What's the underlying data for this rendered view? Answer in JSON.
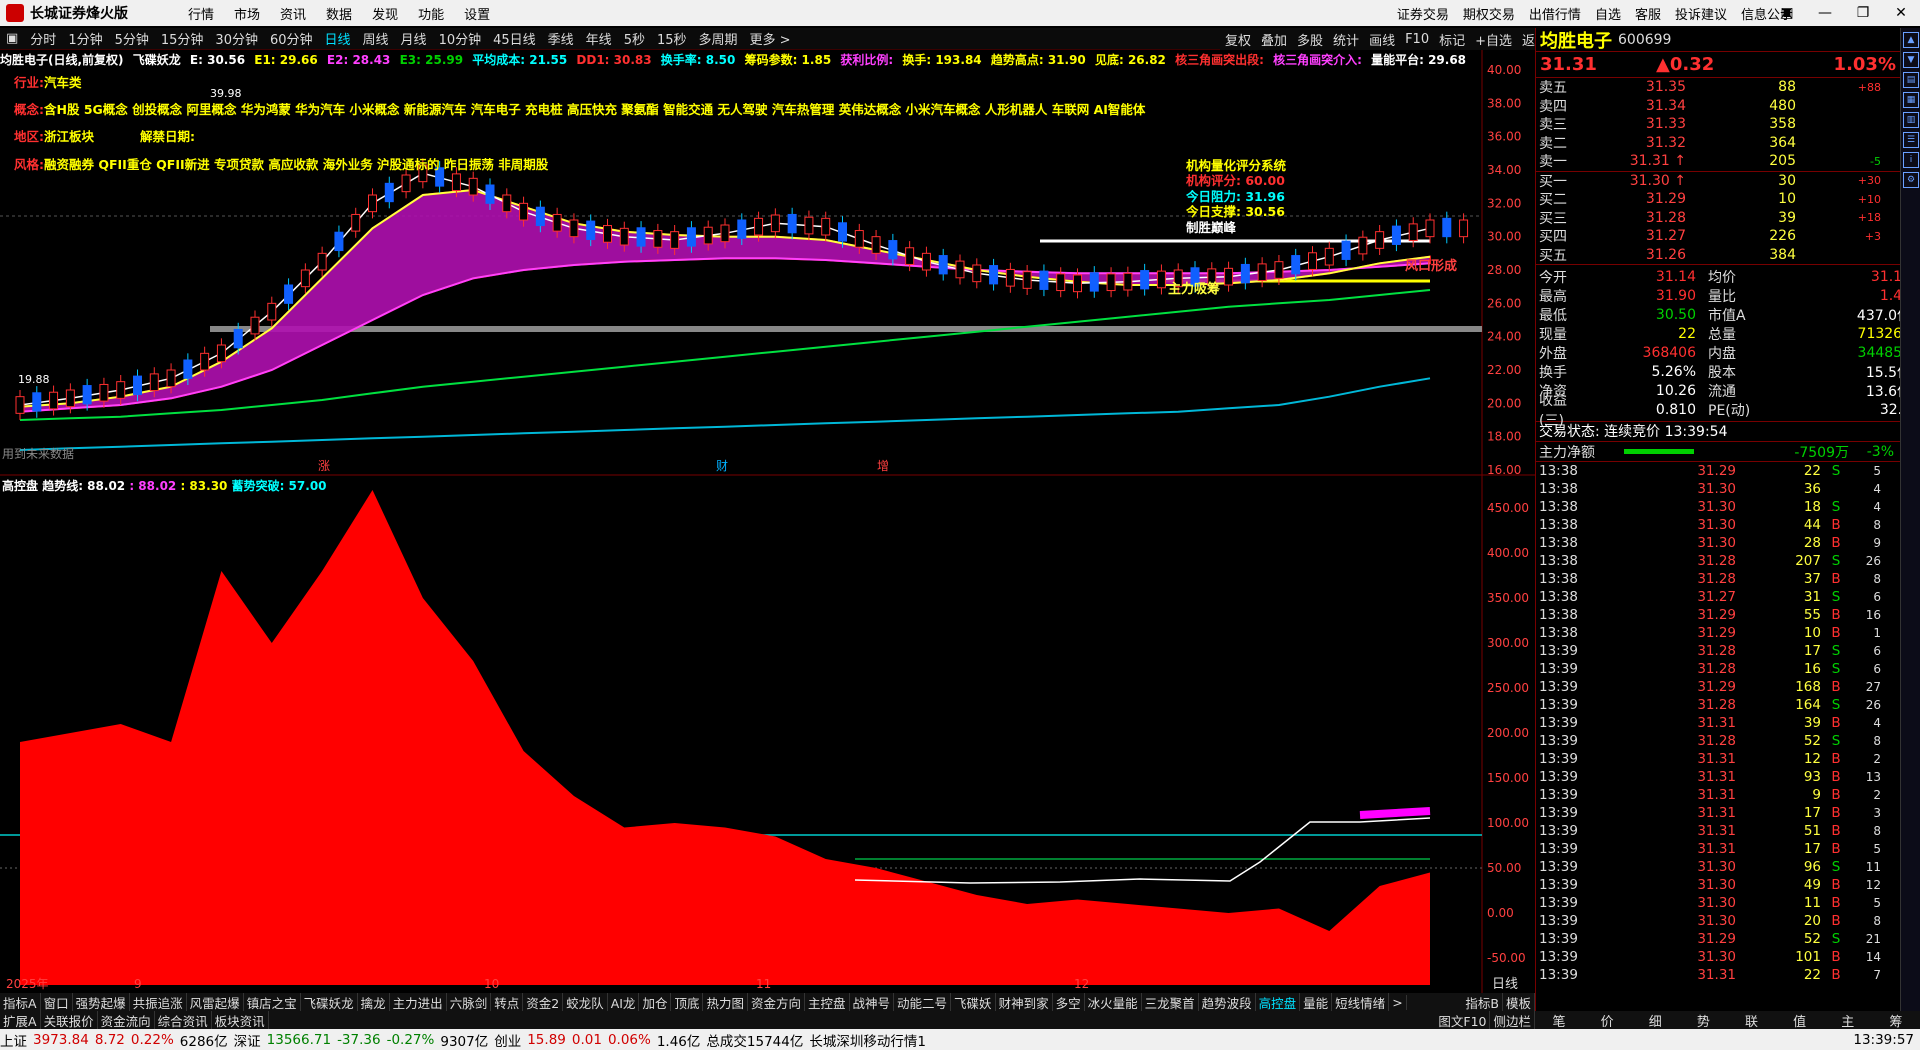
{
  "window": {
    "app_title": "长城证券烽火版",
    "menus": [
      "行情",
      "市场",
      "资讯",
      "数据",
      "发现",
      "功能",
      "设置"
    ],
    "right_menus": [
      "证券交易",
      "期权交易",
      "出借行情",
      "自选",
      "客服",
      "投诉建议",
      "信息公示"
    ],
    "controls": [
      "▣",
      "—",
      "❐",
      "✕"
    ]
  },
  "periods": [
    "分时",
    "1分钟",
    "5分钟",
    "15分钟",
    "30分钟",
    "60分钟",
    "日线",
    "周线",
    "月线",
    "10分钟",
    "45日线",
    "季线",
    "年线",
    "5秒",
    "15秒",
    "多周期",
    "更多 >"
  ],
  "active_period": "日线",
  "chart_tools": [
    "复权",
    "叠加",
    "多股",
    "统计",
    "画线",
    "F10",
    "标记",
    "+自选",
    "返回"
  ],
  "info_bar": {
    "stock": "均胜电子(日线,前复权)",
    "indicator": "飞碟妖龙",
    "e1": "E: 30.56",
    "e1b": "E1: 29.66",
    "e2": "E2: 28.43",
    "e3": "E3: 25.99",
    "avg_cost": "平均成本: 21.55",
    "dd1": "DD1: 30.83",
    "turnover_rate": "换手率: 8.50",
    "chip_param": "筹码参数: 1.85",
    "profit_ratio": "获利比例:",
    "turnover": "换手: 193.84",
    "trend_high": "趋势高点: 31.90",
    "top_hint": "见底: 26.82",
    "triangle_break": "核三角画突出段:",
    "triangle_intervene": "核三角画突介入:",
    "volume_platform": "量能平台: 29.68"
  },
  "stock_info": {
    "industry_label": "行业:",
    "industry": "汽车类",
    "concept_label": "概念:",
    "concept": "含H股 5G概念 创投概念 阿里概念 华为鸿蒙 华为汽车 小米概念 新能源汽车 汽车电子 充电桩 高压快充 聚氨酯 智能交通 无人驾驶 汽车热管理 英伟达概念 小米汽车概念 人形机器人 车联网 AI智能体",
    "region_label": "地区:",
    "region": "浙江板块",
    "unlock_label": "解禁日期:",
    "style_label": "风格:",
    "style": "融资融券 QFII重仓 QFII新进 专项贷款 高应收款 海外业务 沪股通标的 昨日振荡 非周期股"
  },
  "quant_box": {
    "title": "机构量化评分系统",
    "score": "机构评分: 60.00",
    "resistance": "今日阻力: 31.96",
    "support": "今日支撑: 30.56",
    "note": "制胜巅峰"
  },
  "chart_annotations": {
    "peak_price": "39.98",
    "low_price": "19.88",
    "main_label": "主力吸筹",
    "breakout_label": "风口形成",
    "no_future": "用到未来数据",
    "markers": [
      "涨",
      "财",
      "增"
    ],
    "month_labels": [
      "2025年",
      "9",
      "10",
      "11",
      "12",
      "日线"
    ]
  },
  "price_axis": [
    "40.00",
    "38.00",
    "36.00",
    "34.00",
    "32.00",
    "30.00",
    "28.00",
    "26.00",
    "24.00",
    "22.00",
    "20.00",
    "18.00",
    "16.00"
  ],
  "sub_axis": [
    "450.00",
    "400.00",
    "350.00",
    "300.00",
    "250.00",
    "200.00",
    "150.00",
    "100.00",
    "50.00",
    "0.00",
    "-50.00"
  ],
  "sub_indicator": {
    "name": "高控盘",
    "trend": "趋势线: 88.02",
    "v2": ": 88.02",
    "v3": ": 83.30",
    "breakout": "蓄势突破: 57.00"
  },
  "chart_data": [
    {
      "type": "line",
      "ylim": [
        16,
        40
      ],
      "series": [
        {
          "name": "E1",
          "values": [
            19.9,
            20.3,
            20.8,
            21.5,
            23.0,
            25.5,
            28.5,
            32.0,
            33.8,
            33.0,
            31.5,
            30.5,
            30.0,
            29.8,
            30.2,
            30.8,
            30.6,
            29.5,
            28.5,
            27.8,
            27.4,
            27.2,
            27.3,
            27.5,
            27.6,
            28.0,
            28.8,
            29.8,
            30.5
          ]
        },
        {
          "name": "E2",
          "values": [
            19.8,
            20.0,
            20.4,
            21.0,
            22.5,
            24.5,
            27.5,
            30.5,
            32.5,
            32.8,
            31.8,
            30.8,
            30.3,
            30.1,
            30.0,
            30.0,
            29.8,
            29.2,
            28.6,
            28.0,
            27.6,
            27.3,
            27.1,
            27.1,
            27.2,
            27.4,
            27.8,
            28.4,
            28.8
          ]
        },
        {
          "name": "E3",
          "values": [
            19.5,
            19.7,
            19.9,
            20.3,
            21.0,
            22.0,
            23.5,
            25.0,
            26.5,
            27.5,
            28.0,
            28.3,
            28.5,
            28.6,
            28.7,
            28.7,
            28.6,
            28.4,
            28.2,
            28.0,
            27.9,
            27.8,
            27.8,
            27.8,
            27.8,
            27.9,
            28.0,
            28.2,
            28.4
          ]
        },
        {
          "name": "平均成本",
          "values": [
            19.0,
            19.1,
            19.2,
            19.4,
            19.6,
            19.9,
            20.2,
            20.6,
            21.0,
            21.3,
            21.6,
            21.9,
            22.2,
            22.5,
            22.8,
            23.1,
            23.4,
            23.7,
            24.0,
            24.3,
            24.6,
            24.9,
            25.2,
            25.5,
            25.8,
            26.0,
            26.2,
            26.5,
            26.8
          ]
        },
        {
          "name": "DD1",
          "values": [
            17.2,
            17.3,
            17.4,
            17.5,
            17.6,
            17.7,
            17.8,
            17.9,
            18.0,
            18.1,
            18.2,
            18.3,
            18.4,
            18.5,
            18.6,
            18.7,
            18.8,
            18.9,
            19.0,
            19.1,
            19.2,
            19.3,
            19.4,
            19.5,
            19.7,
            19.9,
            20.4,
            21.0,
            21.5
          ]
        }
      ]
    },
    {
      "type": "area",
      "ylim": [
        -80,
        470
      ],
      "series": [
        {
          "name": "高控盘",
          "values": [
            190,
            200,
            210,
            190,
            380,
            300,
            380,
            470,
            350,
            280,
            180,
            130,
            95,
            100,
            95,
            85,
            60,
            50,
            35,
            20,
            10,
            15,
            10,
            5,
            0,
            5,
            -20,
            30,
            45
          ]
        }
      ]
    }
  ],
  "quote_panel": {
    "name": "均胜电子",
    "code": "600699",
    "price": "31.31",
    "change": "▲0.32",
    "pct": "1.03%",
    "asks": [
      {
        "label": "卖五",
        "price": "31.35",
        "vol": "88",
        "chg": "+88"
      },
      {
        "label": "卖四",
        "price": "31.34",
        "vol": "480",
        "chg": ""
      },
      {
        "label": "卖三",
        "price": "31.33",
        "vol": "358",
        "chg": ""
      },
      {
        "label": "卖二",
        "price": "31.32",
        "vol": "364",
        "chg": ""
      },
      {
        "label": "卖一",
        "price": "31.31 ↑",
        "vol": "205",
        "chg": "-5"
      }
    ],
    "bids": [
      {
        "label": "买一",
        "price": "31.30 ↑",
        "vol": "30",
        "chg": "+30"
      },
      {
        "label": "买二",
        "price": "31.29",
        "vol": "10",
        "chg": "+10"
      },
      {
        "label": "买三",
        "price": "31.28",
        "vol": "39",
        "chg": "+18"
      },
      {
        "label": "买四",
        "price": "31.27",
        "vol": "226",
        "chg": "+3"
      },
      {
        "label": "买五",
        "price": "31.26",
        "vol": "384",
        "chg": ""
      }
    ],
    "stats": [
      {
        "k": "今开",
        "v": "31.14",
        "k2": "均价",
        "v2": "31.19"
      },
      {
        "k": "最高",
        "v": "31.90",
        "k2": "量比",
        "v2": "1.42"
      },
      {
        "k": "最低",
        "v": "30.50",
        "k2": "市值A",
        "v2": "437.0亿"
      },
      {
        "k": "现量",
        "v": "22",
        "k2": "总量",
        "v2": "713262"
      },
      {
        "k": "外盘",
        "v": "368406",
        "k2": "内盘",
        "v2": "344856"
      },
      {
        "k": "换手",
        "v": "5.26%",
        "k2": "股本",
        "v2": "15.5亿"
      },
      {
        "k": "净资",
        "v": "10.26",
        "k2": "流通",
        "v2": "13.6亿"
      },
      {
        "k": "收益(三)",
        "v": "0.810",
        "k2": "PE(动)",
        "v2": "32.5"
      }
    ],
    "trade_status": "交易状态: 连续竞价 13:39:54",
    "main_flow_label": "主力净额",
    "main_flow_value": "-7509万",
    "main_flow_pct": "-3%",
    "ticks": [
      {
        "t": "13:38",
        "p": "31.29",
        "v": "22",
        "bs": "S",
        "n": "5"
      },
      {
        "t": "13:38",
        "p": "31.30",
        "v": "36",
        "bs": "",
        "n": "4"
      },
      {
        "t": "13:38",
        "p": "31.30",
        "v": "18",
        "bs": "S",
        "n": "4"
      },
      {
        "t": "13:38",
        "p": "31.30",
        "v": "44",
        "bs": "B",
        "n": "8"
      },
      {
        "t": "13:38",
        "p": "31.30",
        "v": "28",
        "bs": "B",
        "n": "9"
      },
      {
        "t": "13:38",
        "p": "31.28",
        "v": "207",
        "bs": "S",
        "n": "26"
      },
      {
        "t": "13:38",
        "p": "31.28",
        "v": "37",
        "bs": "B",
        "n": "8"
      },
      {
        "t": "13:38",
        "p": "31.27",
        "v": "31",
        "bs": "S",
        "n": "6"
      },
      {
        "t": "13:38",
        "p": "31.29",
        "v": "55",
        "bs": "B",
        "n": "16"
      },
      {
        "t": "13:38",
        "p": "31.29",
        "v": "10",
        "bs": "B",
        "n": "1"
      },
      {
        "t": "13:39",
        "p": "31.28",
        "v": "17",
        "bs": "S",
        "n": "6"
      },
      {
        "t": "13:39",
        "p": "31.28",
        "v": "16",
        "bs": "S",
        "n": "6"
      },
      {
        "t": "13:39",
        "p": "31.29",
        "v": "168",
        "bs": "B",
        "n": "27"
      },
      {
        "t": "13:39",
        "p": "31.28",
        "v": "164",
        "bs": "S",
        "n": "26"
      },
      {
        "t": "13:39",
        "p": "31.31",
        "v": "39",
        "bs": "B",
        "n": "4"
      },
      {
        "t": "13:39",
        "p": "31.28",
        "v": "52",
        "bs": "S",
        "n": "8"
      },
      {
        "t": "13:39",
        "p": "31.31",
        "v": "12",
        "bs": "B",
        "n": "2"
      },
      {
        "t": "13:39",
        "p": "31.31",
        "v": "93",
        "bs": "B",
        "n": "13"
      },
      {
        "t": "13:39",
        "p": "31.31",
        "v": "9",
        "bs": "B",
        "n": "2"
      },
      {
        "t": "13:39",
        "p": "31.31",
        "v": "17",
        "bs": "B",
        "n": "3"
      },
      {
        "t": "13:39",
        "p": "31.31",
        "v": "51",
        "bs": "B",
        "n": "8"
      },
      {
        "t": "13:39",
        "p": "31.31",
        "v": "17",
        "bs": "B",
        "n": "5"
      },
      {
        "t": "13:39",
        "p": "31.30",
        "v": "96",
        "bs": "S",
        "n": "11"
      },
      {
        "t": "13:39",
        "p": "31.30",
        "v": "49",
        "bs": "B",
        "n": "12"
      },
      {
        "t": "13:39",
        "p": "31.30",
        "v": "11",
        "bs": "B",
        "n": "5"
      },
      {
        "t": "13:39",
        "p": "31.30",
        "v": "20",
        "bs": "B",
        "n": "8"
      },
      {
        "t": "13:39",
        "p": "31.29",
        "v": "52",
        "bs": "S",
        "n": "21"
      },
      {
        "t": "13:39",
        "p": "31.30",
        "v": "101",
        "bs": "B",
        "n": "14"
      },
      {
        "t": "13:39",
        "p": "31.31",
        "v": "22",
        "bs": "B",
        "n": "7"
      }
    ]
  },
  "indicator_tabs": [
    "指标A",
    "窗口",
    "强势起爆",
    "共振追涨",
    "风雷起爆",
    "镇店之宝",
    "飞碟妖龙",
    "擒龙",
    "主力进出",
    "六脉剑",
    "转点",
    "资金2",
    "蛟龙队",
    "AI龙",
    "加仓",
    "顶底",
    "热力图",
    "资金方向",
    "主控盘",
    "战神号",
    "动能二号",
    "飞碟妖",
    "财神到家",
    "多空",
    "冰火量能",
    "三龙聚首",
    "趋势波段",
    "高控盘",
    "量能",
    "短线情绪",
    ">"
  ],
  "active_indicator_tab": "高控盘",
  "indicator_tabs_right": [
    "指标B",
    "模板"
  ],
  "bottom_tabs": [
    "扩展A",
    "关联报价",
    "资金流向",
    "综合资讯",
    "板块资讯"
  ],
  "bottom_right_tabs": [
    "图文F10",
    "侧边栏"
  ],
  "rp_tabs": [
    "笔",
    "价",
    "细",
    "势",
    "联",
    "值",
    "主",
    "筹"
  ],
  "status": {
    "sh_label": "上证",
    "sh": "3973.84",
    "sh_chg": "8.72",
    "sh_pct": "0.22%",
    "sh_amt": "6286亿",
    "sz_label": "深证",
    "sz": "13566.71",
    "sz_chg": "-37.36",
    "sz_pct": "-0.27%",
    "sz_amt": "9307亿",
    "cy_label": "创业",
    "cy": "15.89",
    "cy_chg": "0.01",
    "cy_pct": "0.06%",
    "cy_amt": "1.46亿",
    "total": "总成交15744亿",
    "server": "长城深圳移动行情1",
    "time": "13:39:57"
  },
  "colors": {
    "up": "#ff3030",
    "down": "#00d0d0",
    "accent": "#00e0ff",
    "area": "#ff0000"
  }
}
